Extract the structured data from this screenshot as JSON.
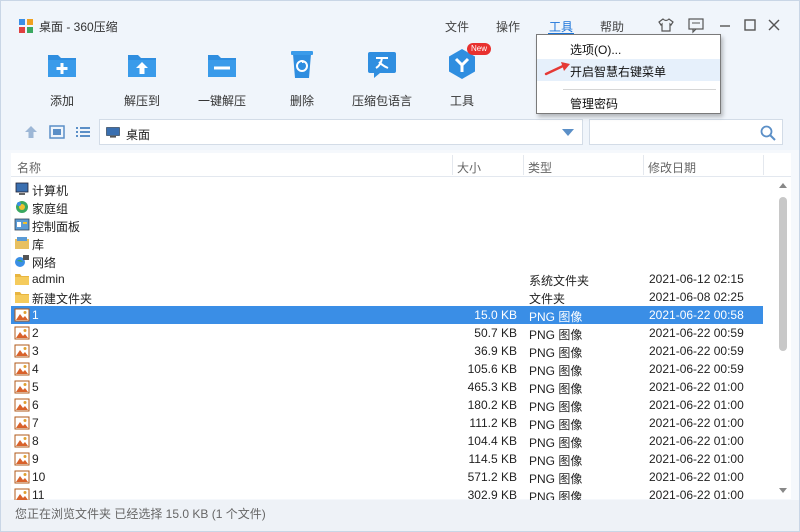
{
  "window": {
    "title": "桌面 - 360压缩",
    "menus": [
      "文件",
      "操作",
      "工具",
      "帮助"
    ],
    "active_menu": "工具"
  },
  "toolbar": {
    "items": [
      {
        "label": "添加",
        "icon": "add-icon"
      },
      {
        "label": "解压到",
        "icon": "extract-to-icon"
      },
      {
        "label": "一键解压",
        "icon": "one-click-extract-icon"
      },
      {
        "label": "删除",
        "icon": "delete-icon"
      },
      {
        "label": "压缩包语言",
        "icon": "archive-language-icon"
      },
      {
        "label": "工具",
        "icon": "tools-icon"
      }
    ],
    "new_badge": "New"
  },
  "address": {
    "path": "桌面"
  },
  "search": {
    "value": "",
    "placeholder": ""
  },
  "columns": {
    "name": "名称",
    "size": "大小",
    "type": "类型",
    "date": "修改日期"
  },
  "files": [
    {
      "name": "计算机",
      "size": "",
      "type": "",
      "date": "",
      "icon": "computer-icon"
    },
    {
      "name": "家庭组",
      "size": "",
      "type": "",
      "date": "",
      "icon": "homegroup-icon"
    },
    {
      "name": "控制面板",
      "size": "",
      "type": "",
      "date": "",
      "icon": "control-panel-icon"
    },
    {
      "name": "库",
      "size": "",
      "type": "",
      "date": "",
      "icon": "library-icon"
    },
    {
      "name": "网络",
      "size": "",
      "type": "",
      "date": "",
      "icon": "network-icon"
    },
    {
      "name": "admin",
      "size": "",
      "type": "系统文件夹",
      "date": "2021-06-12 02:15",
      "icon": "folder-icon"
    },
    {
      "name": "新建文件夹",
      "size": "",
      "type": "文件夹",
      "date": "2021-06-08 02:25",
      "icon": "folder-icon"
    },
    {
      "name": "1",
      "size": "15.0 KB",
      "type": "PNG 图像",
      "date": "2021-06-22 00:58",
      "icon": "image-icon",
      "selected": true
    },
    {
      "name": "2",
      "size": "50.7 KB",
      "type": "PNG 图像",
      "date": "2021-06-22 00:59",
      "icon": "image-icon"
    },
    {
      "name": "3",
      "size": "36.9 KB",
      "type": "PNG 图像",
      "date": "2021-06-22 00:59",
      "icon": "image-icon"
    },
    {
      "name": "4",
      "size": "105.6 KB",
      "type": "PNG 图像",
      "date": "2021-06-22 00:59",
      "icon": "image-icon"
    },
    {
      "name": "5",
      "size": "465.3 KB",
      "type": "PNG 图像",
      "date": "2021-06-22 01:00",
      "icon": "image-icon"
    },
    {
      "name": "6",
      "size": "180.2 KB",
      "type": "PNG 图像",
      "date": "2021-06-22 01:00",
      "icon": "image-icon"
    },
    {
      "name": "7",
      "size": "111.2 KB",
      "type": "PNG 图像",
      "date": "2021-06-22 01:00",
      "icon": "image-icon"
    },
    {
      "name": "8",
      "size": "104.4 KB",
      "type": "PNG 图像",
      "date": "2021-06-22 01:00",
      "icon": "image-icon"
    },
    {
      "name": "9",
      "size": "114.5 KB",
      "type": "PNG 图像",
      "date": "2021-06-22 01:00",
      "icon": "image-icon"
    },
    {
      "name": "10",
      "size": "571.2 KB",
      "type": "PNG 图像",
      "date": "2021-06-22 01:00",
      "icon": "image-icon"
    },
    {
      "name": "11",
      "size": "302.9 KB",
      "type": "PNG 图像",
      "date": "2021-06-22 01:00",
      "icon": "image-icon"
    }
  ],
  "status": {
    "text": "您正在浏览文件夹 已经选择 15.0 KB (1 个文件)"
  },
  "tools_menu": {
    "items": [
      {
        "label": "选项(O)..."
      },
      {
        "label": "开启智慧右键菜单"
      },
      {
        "label": "管理密码"
      }
    ]
  },
  "colors": {
    "accent": "#1a73d9",
    "selection": "#3a8ee6",
    "toolbar_icon": "#2f8ee0",
    "annotation_arrow": "#e53935"
  }
}
